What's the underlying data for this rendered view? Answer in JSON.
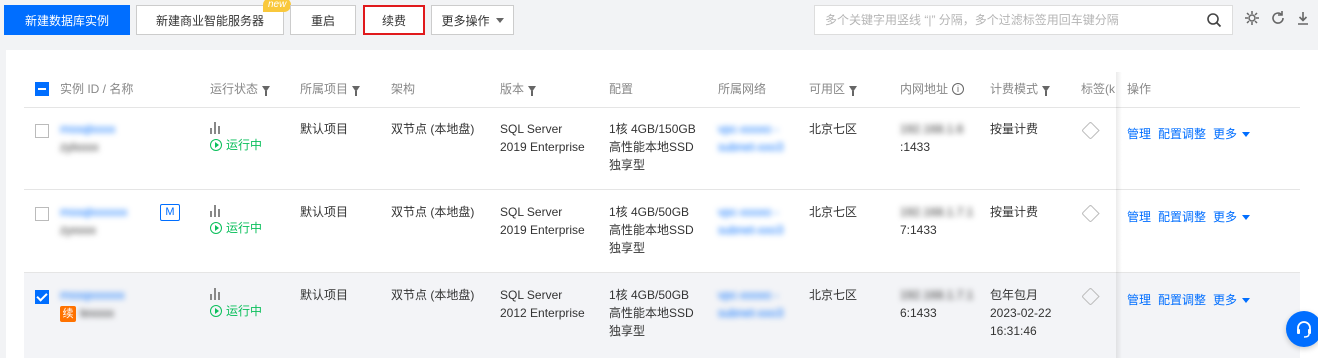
{
  "toolbar": {
    "create_db": "新建数据库实例",
    "create_bi": "新建商业智能服务器",
    "new_badge": "new",
    "restart": "重启",
    "renew": "续费",
    "more_ops": "更多操作",
    "search_placeholder": "多个关键字用竖线 “|” 分隔，多个过滤标签用回车键分隔",
    "icons": [
      "search-icon",
      "gear-icon",
      "refresh-icon",
      "download-icon"
    ]
  },
  "table": {
    "headers": {
      "id_name": "实例 ID / 名称",
      "status": "运行状态",
      "project": "所属项目",
      "arch": "架构",
      "version": "版本",
      "config": "配置",
      "network": "所属网络",
      "zone": "可用区",
      "ip": "内网地址",
      "billing": "计费模式",
      "tags": "标签(k",
      "ops": "操作"
    },
    "rows": [
      {
        "selected": false,
        "id": "mssqlxxxx",
        "name": "zylxxxx",
        "status": "运行中",
        "project": "默认项目",
        "arch": "双节点 (本地盘)",
        "version_line1": "SQL Server",
        "version_line2": "2019 Enterprise",
        "config_line1": "1核 4GB/150GB",
        "config_line2": "高性能本地SSD",
        "config_line3": "独享型",
        "net_line1": "vpc-xxxxo -",
        "net_line2": "subnet-xxo3",
        "zone": "北京七区",
        "ip_line1": "192.168.1.6",
        "ip_line2": ":1433",
        "billing_line1": "按量计费",
        "billing_line2": "",
        "billing_line3": "",
        "badge": ""
      },
      {
        "selected": false,
        "id": "mssqlxxxxxx",
        "name": "zyxxxx",
        "status": "运行中",
        "project": "默认项目",
        "arch": "双节点 (本地盘)",
        "version_line1": "SQL Server",
        "version_line2": "2019 Enterprise",
        "config_line1": "1核 4GB/50GB",
        "config_line2": "高性能本地SSD",
        "config_line3": "独享型",
        "net_line1": "vpc-xxxxo -",
        "net_line2": "subnet-xxo3",
        "zone": "北京七区",
        "ip_line1": "192.168.1.7.1",
        "ip_line2": "7:1433",
        "billing_line1": "按量计费",
        "billing_line2": "",
        "billing_line3": "",
        "badge": "M"
      },
      {
        "selected": true,
        "id": "mssqxxxxxx",
        "name": "texxxx",
        "status": "运行中",
        "project": "默认项目",
        "arch": "双节点 (本地盘)",
        "version_line1": "SQL Server",
        "version_line2": "2012 Enterprise",
        "config_line1": "1核 4GB/50GB",
        "config_line2": "高性能本地SSD",
        "config_line3": "独享型",
        "net_line1": "vpc-xxxxo -",
        "net_line2": "subnet-xxo3",
        "zone": "北京七区",
        "ip_line1": "192.168.1.7.1",
        "ip_line2": "6:1433",
        "billing_line1": "包年包月",
        "billing_line2": "2023-02-22",
        "billing_line3": "16:31:46",
        "badge": "续"
      }
    ],
    "ops": {
      "manage": "管理",
      "adjust": "配置调整",
      "more": "更多"
    }
  },
  "colors": {
    "primary": "#006eff",
    "running": "#0abf5b",
    "renew_border": "#e0191c",
    "renew_badge": "#ff7200"
  }
}
